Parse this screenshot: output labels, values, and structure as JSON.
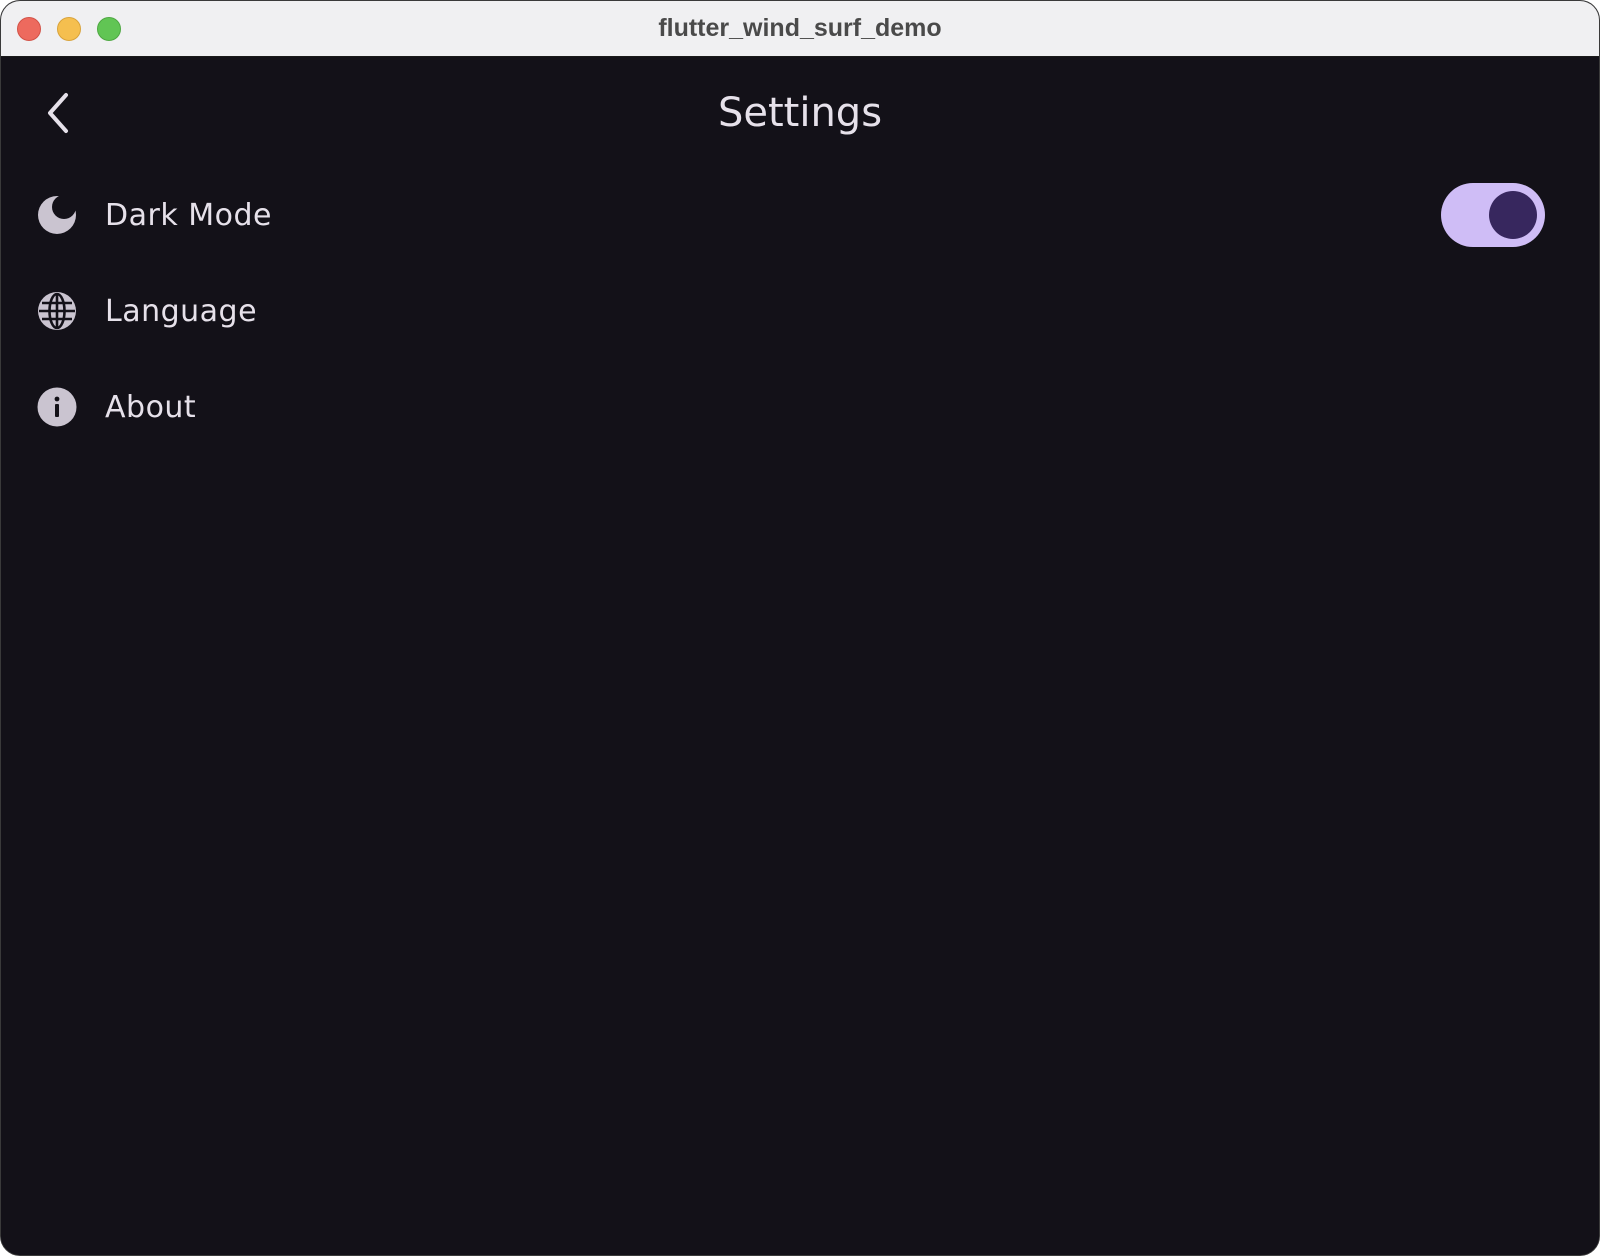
{
  "window": {
    "title": "flutter_wind_surf_demo"
  },
  "header": {
    "back_icon": "chevron-left-icon",
    "title": "Settings"
  },
  "settings": {
    "items": [
      {
        "label": "Dark Mode",
        "icon": "moon-icon",
        "has_toggle": true,
        "toggle_on": true
      },
      {
        "label": "Language",
        "icon": "globe-icon",
        "has_toggle": false
      },
      {
        "label": "About",
        "icon": "info-icon",
        "has_toggle": false
      }
    ]
  },
  "colors": {
    "background": "#131118",
    "text": "#e6e1ea",
    "icon": "#cac4d0",
    "toggle_track": "#cfbdf6",
    "toggle_knob": "#37275e"
  }
}
